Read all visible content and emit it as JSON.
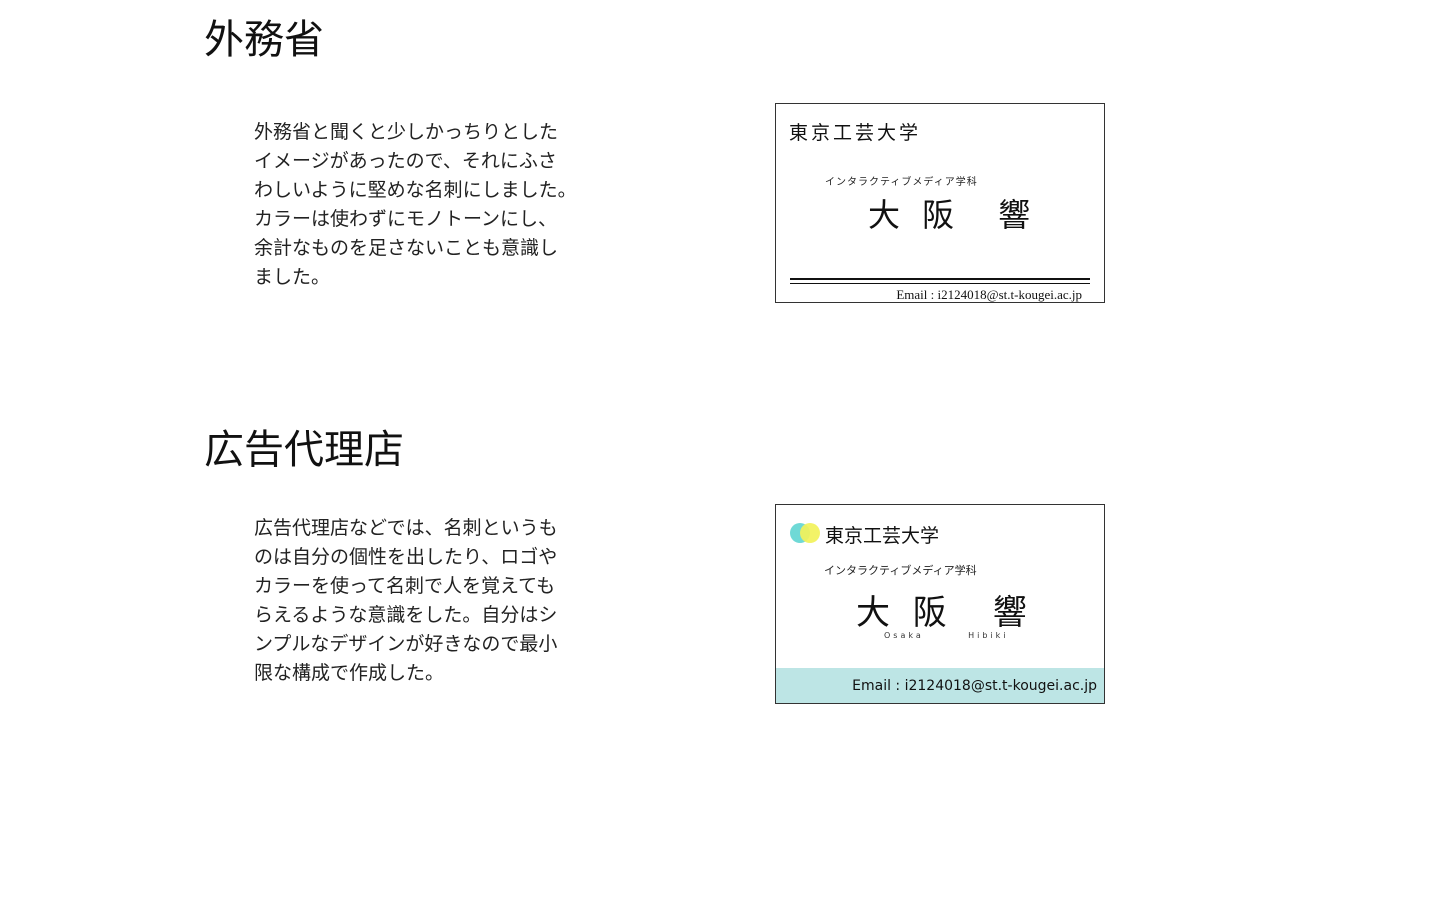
{
  "sections": [
    {
      "title": "外務省",
      "description_lines": [
        "外務省と聞くと少しかっちりとした",
        "イメージがあったので、それにふさ",
        "わしいように堅めな名刺にしました。",
        "カラーは使わずにモノトーンにし、",
        "余計なものを足さないことも意識し",
        "ました。"
      ],
      "card": {
        "university": "東京工芸大学",
        "department": "インタラクティブメディア学科",
        "name": "大 阪　響",
        "email": "Email : i2124018@st.t-kougei.ac.jp"
      }
    },
    {
      "title": "広告代理店",
      "description_lines": [
        "広告代理店などでは、名刺というも",
        "のは自分の個性を出したり、ロゴや",
        "カラーを使って名刺で人を覚えても",
        "らえるような意識をした。自分はシ",
        "ンプルなデザインが好きなので最小",
        "限な構成で作成した。"
      ],
      "card": {
        "university": "東京工芸大学",
        "department": "インタラクティブメディア学科",
        "name": "大 阪　響",
        "romanization": "Osaka        Hibiki",
        "email": "Email : i2124018@st.t-kougei.ac.jp",
        "logo_colors": [
          "#6fd9d6",
          "#f2f25a"
        ],
        "footer_color": "#bde5e5"
      }
    }
  ]
}
